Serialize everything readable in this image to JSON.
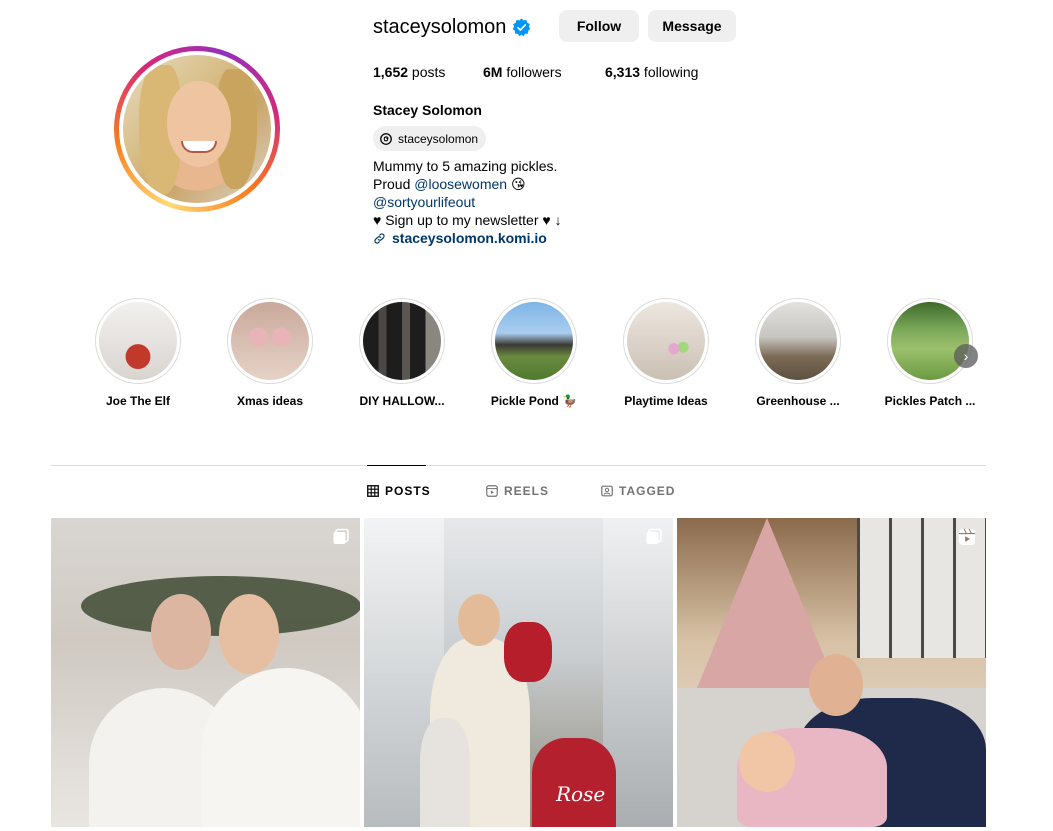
{
  "profile": {
    "username": "staceysolomon",
    "full_name": "Stacey Solomon",
    "threads_handle": "staceysolomon",
    "follow_label": "Follow",
    "message_label": "Message",
    "stats": {
      "posts_count": "1,652",
      "posts_label": " posts",
      "followers_count": "6M",
      "followers_label": " followers",
      "following_count": "6,313",
      "following_label": " following"
    },
    "bio": {
      "line1": "Mummy to 5 amazing pickles.",
      "line2_prefix": "Proud ",
      "line2_mention": "@loosewomen",
      "line2_emoji": "😘",
      "line3_mention": "@sortyourlifeout",
      "line4": "♥ Sign up to my newsletter ♥ ↓",
      "link": "staceysolomon.komi.io"
    }
  },
  "highlights": [
    {
      "label": "Joe The Elf",
      "colors": [
        "#e9e6e4",
        "#c0392b"
      ]
    },
    {
      "label": "Xmas ideas",
      "colors": [
        "#caa79a",
        "#e7c8c0"
      ]
    },
    {
      "label": "DIY HALLOW...",
      "colors": [
        "#2a2a2a",
        "#8a8680"
      ]
    },
    {
      "label": "Pickle Pond 🦆",
      "colors": [
        "#6aa7d8",
        "#5b7d3a"
      ]
    },
    {
      "label": "Playtime Ideas",
      "colors": [
        "#e8e2dc",
        "#c7b8a9"
      ]
    },
    {
      "label": "Greenhouse ...",
      "colors": [
        "#d9d9d6",
        "#7b6a55"
      ]
    },
    {
      "label": "Pickles Patch ...",
      "colors": [
        "#5e8f3a",
        "#a7c57b"
      ]
    }
  ],
  "tabs": [
    {
      "label": "POSTS",
      "active": true
    },
    {
      "label": "REELS",
      "active": false
    },
    {
      "label": "TAGGED",
      "active": false
    }
  ],
  "posts": [
    {
      "type": "carousel",
      "caption_text": ""
    },
    {
      "type": "carousel",
      "caption_text": "Rose"
    },
    {
      "type": "reel",
      "caption_text": ""
    }
  ],
  "colors": {
    "verified_blue": "#0095f6",
    "link_blue": "#00376b",
    "button_gray": "#efefef",
    "divider": "#dbdbdb"
  }
}
